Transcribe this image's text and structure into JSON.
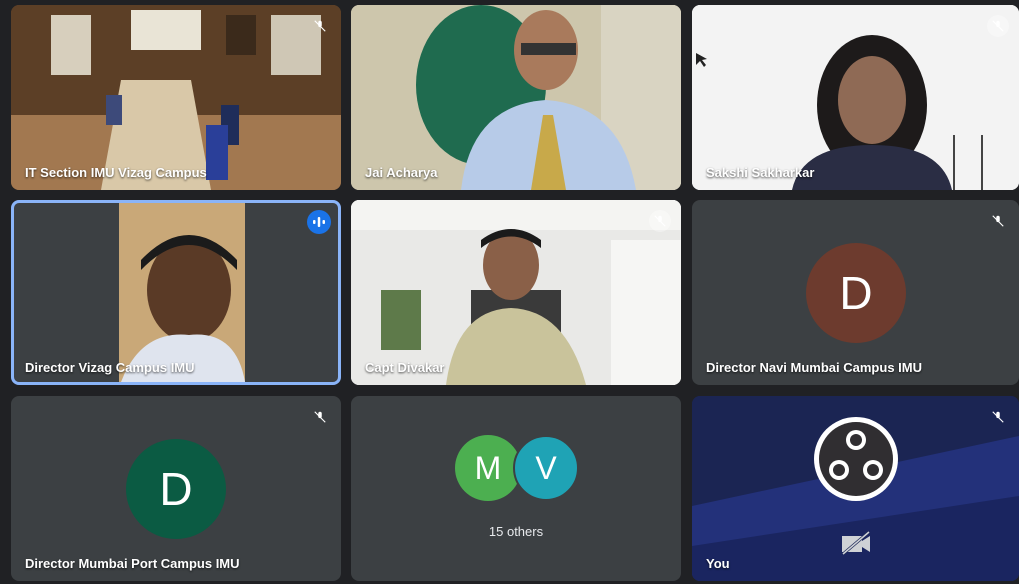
{
  "colors": {
    "tile_bg": "#3c4043",
    "active_border": "#8ab4f8",
    "speaking_badge": "#1a73e8",
    "avatar_director_navi": "#6d3b2e",
    "avatar_director_mumbai": "#0b5b43",
    "avatar_m": "#4caf50",
    "avatar_v": "#1fa3b5",
    "self_bg": "#1e2a5a"
  },
  "tiles": [
    {
      "name": "IT Section IMU Vizag Campus",
      "muted": true,
      "video": true
    },
    {
      "name": "Jai Acharya",
      "muted": false,
      "video": true
    },
    {
      "name": "Sakshi Sakharkar",
      "muted": true,
      "video": true
    },
    {
      "name": "Director Vizag Campus IMU",
      "muted": false,
      "speaking": true,
      "video": true
    },
    {
      "name": "Capt Divakar",
      "muted": true,
      "video": true
    },
    {
      "name": "Director Navi Mumbai Campus IMU",
      "muted": true,
      "avatar_letter": "D"
    },
    {
      "name": "Director Mumbai Port Campus IMU",
      "muted": true,
      "avatar_letter": "D"
    },
    {
      "others_label": "15 others",
      "avatar_letters": [
        "M",
        "V"
      ]
    },
    {
      "name": "You",
      "muted": true,
      "camera_off": true
    }
  ]
}
